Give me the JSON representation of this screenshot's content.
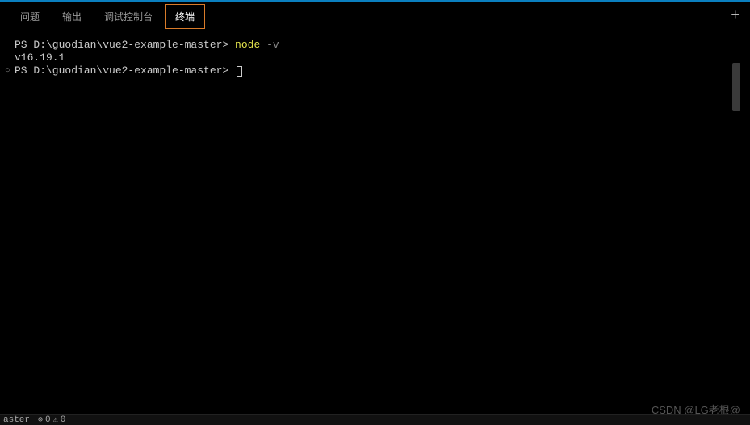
{
  "tabs": {
    "problems": "问题",
    "output": "输出",
    "debug_console": "调试控制台",
    "terminal": "终端"
  },
  "terminal": {
    "line1": {
      "prompt": "PS D:\\guodian\\vue2-example-master> ",
      "cmd": "node",
      "flag": " -v"
    },
    "line2": "v16.19.1",
    "line3": {
      "gutter": "○",
      "prompt": "PS D:\\guodian\\vue2-example-master> "
    }
  },
  "status": {
    "branch": "aster",
    "errors": "0",
    "warnings": "0"
  },
  "watermark": "CSDN @LG老根@"
}
